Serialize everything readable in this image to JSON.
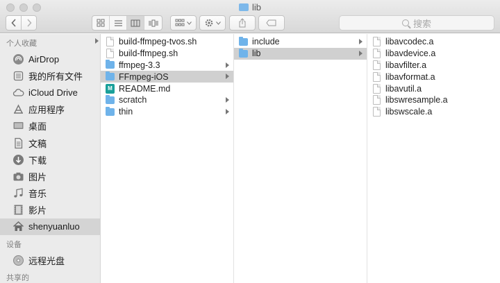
{
  "window": {
    "title": "lib"
  },
  "toolbar": {
    "search_placeholder": "搜索",
    "icons": [
      "chevron-left-icon",
      "chevron-right-icon",
      "icon-view-icon",
      "list-view-icon",
      "column-view-icon",
      "cover-flow-icon",
      "arrange-icon",
      "gear-icon",
      "share-icon",
      "tag-icon"
    ]
  },
  "sidebar": {
    "favorites_header": "个人收藏",
    "favorites": [
      {
        "label": "AirDrop",
        "icon": "airdrop-icon"
      },
      {
        "label": "我的所有文件",
        "icon": "all-files-icon"
      },
      {
        "label": "iCloud Drive",
        "icon": "cloud-icon"
      },
      {
        "label": "应用程序",
        "icon": "applications-icon"
      },
      {
        "label": "桌面",
        "icon": "desktop-icon"
      },
      {
        "label": "文稿",
        "icon": "document-icon"
      },
      {
        "label": "下载",
        "icon": "download-icon"
      },
      {
        "label": "图片",
        "icon": "camera-icon"
      },
      {
        "label": "音乐",
        "icon": "music-icon"
      },
      {
        "label": "影片",
        "icon": "film-icon"
      },
      {
        "label": "shenyuanluo",
        "icon": "home-icon",
        "selected": true
      }
    ],
    "devices_header": "设备",
    "devices": [
      {
        "label": "远程光盘",
        "icon": "disc-icon"
      }
    ],
    "shared_header": "共享的"
  },
  "columns": [
    {
      "items": [
        {
          "label": "build-ffmpeg-tvos.sh",
          "type": "file"
        },
        {
          "label": "build-ffmpeg.sh",
          "type": "file"
        },
        {
          "label": "ffmpeg-3.3",
          "type": "folder"
        },
        {
          "label": "FFmpeg-iOS",
          "type": "folder",
          "selected": true
        },
        {
          "label": "README.md",
          "type": "markdown"
        },
        {
          "label": "scratch",
          "type": "folder"
        },
        {
          "label": "thin",
          "type": "folder"
        }
      ]
    },
    {
      "items": [
        {
          "label": "include",
          "type": "folder"
        },
        {
          "label": "lib",
          "type": "folder",
          "selected": true
        }
      ]
    },
    {
      "items": [
        {
          "label": "libavcodec.a",
          "type": "file"
        },
        {
          "label": "libavdevice.a",
          "type": "file"
        },
        {
          "label": "libavfilter.a",
          "type": "file"
        },
        {
          "label": "libavformat.a",
          "type": "file"
        },
        {
          "label": "libavutil.a",
          "type": "file"
        },
        {
          "label": "libswresample.a",
          "type": "file"
        },
        {
          "label": "libswscale.a",
          "type": "file"
        }
      ]
    }
  ]
}
